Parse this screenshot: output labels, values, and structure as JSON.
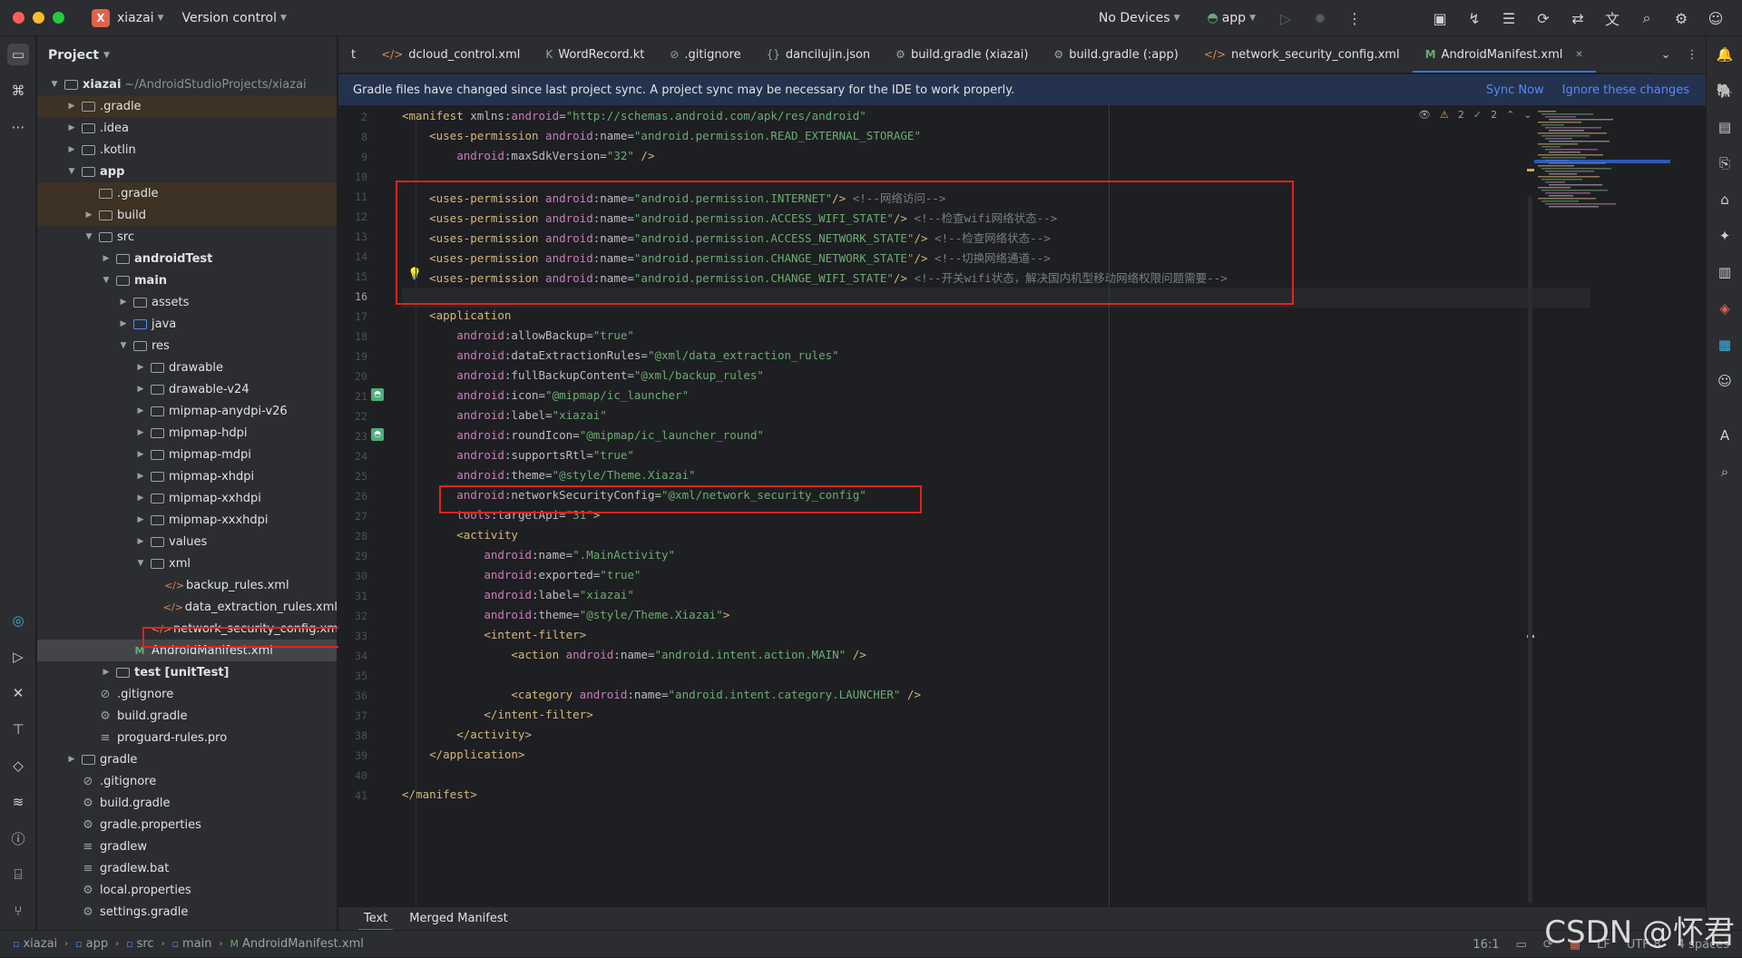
{
  "titlebar": {
    "project_name": "xiazai",
    "project_initial": "X",
    "vcs_label": "Version control",
    "device": "No Devices",
    "run_config": "app"
  },
  "project_panel": {
    "title": "Project",
    "tree": [
      {
        "label": "xiazai",
        "suffix": "~/AndroidStudioProjects/xiazai",
        "depth": 0,
        "arrow": "down",
        "kind": "module",
        "bold": true
      },
      {
        "label": ".gradle",
        "depth": 1,
        "arrow": "right",
        "kind": "folder",
        "hl": "gradle"
      },
      {
        "label": ".idea",
        "depth": 1,
        "arrow": "right",
        "kind": "folder"
      },
      {
        "label": ".kotlin",
        "depth": 1,
        "arrow": "right",
        "kind": "folder"
      },
      {
        "label": "app",
        "depth": 1,
        "arrow": "down",
        "kind": "module",
        "bold": true
      },
      {
        "label": ".gradle",
        "depth": 2,
        "arrow": "",
        "kind": "folder",
        "hl": "gradle"
      },
      {
        "label": "build",
        "depth": 2,
        "arrow": "right",
        "kind": "folder",
        "hl": "gradle"
      },
      {
        "label": "src",
        "depth": 2,
        "arrow": "down",
        "kind": "folder"
      },
      {
        "label": "androidTest",
        "depth": 3,
        "arrow": "right",
        "kind": "module",
        "bold": true
      },
      {
        "label": "main",
        "depth": 3,
        "arrow": "down",
        "kind": "module",
        "bold": true
      },
      {
        "label": "assets",
        "depth": 4,
        "arrow": "right",
        "kind": "module"
      },
      {
        "label": "java",
        "depth": 4,
        "arrow": "right",
        "kind": "blue"
      },
      {
        "label": "res",
        "depth": 4,
        "arrow": "down",
        "kind": "module"
      },
      {
        "label": "drawable",
        "depth": 5,
        "arrow": "right",
        "kind": "folder"
      },
      {
        "label": "drawable-v24",
        "depth": 5,
        "arrow": "right",
        "kind": "folder"
      },
      {
        "label": "mipmap-anydpi-v26",
        "depth": 5,
        "arrow": "right",
        "kind": "folder"
      },
      {
        "label": "mipmap-hdpi",
        "depth": 5,
        "arrow": "right",
        "kind": "folder"
      },
      {
        "label": "mipmap-mdpi",
        "depth": 5,
        "arrow": "right",
        "kind": "folder"
      },
      {
        "label": "mipmap-xhdpi",
        "depth": 5,
        "arrow": "right",
        "kind": "folder"
      },
      {
        "label": "mipmap-xxhdpi",
        "depth": 5,
        "arrow": "right",
        "kind": "folder"
      },
      {
        "label": "mipmap-xxxhdpi",
        "depth": 5,
        "arrow": "right",
        "kind": "folder"
      },
      {
        "label": "values",
        "depth": 5,
        "arrow": "right",
        "kind": "folder"
      },
      {
        "label": "xml",
        "depth": 5,
        "arrow": "down",
        "kind": "folder"
      },
      {
        "label": "backup_rules.xml",
        "depth": 6,
        "arrow": "",
        "kind": "xml"
      },
      {
        "label": "data_extraction_rules.xml",
        "depth": 6,
        "arrow": "",
        "kind": "xml"
      },
      {
        "label": "network_security_config.xml",
        "depth": 6,
        "arrow": "",
        "kind": "xml"
      },
      {
        "label": "AndroidManifest.xml",
        "depth": 4,
        "arrow": "",
        "kind": "manifest",
        "hl": "sel"
      },
      {
        "label": "test [unitTest]",
        "depth": 3,
        "arrow": "right",
        "kind": "module",
        "bold": true
      },
      {
        "label": ".gitignore",
        "depth": 2,
        "arrow": "",
        "kind": "ignore"
      },
      {
        "label": "build.gradle",
        "depth": 2,
        "arrow": "",
        "kind": "gradle"
      },
      {
        "label": "proguard-rules.pro",
        "depth": 2,
        "arrow": "",
        "kind": "text"
      },
      {
        "label": "gradle",
        "depth": 1,
        "arrow": "right",
        "kind": "folder"
      },
      {
        "label": ".gitignore",
        "depth": 1,
        "arrow": "",
        "kind": "ignore"
      },
      {
        "label": "build.gradle",
        "depth": 1,
        "arrow": "",
        "kind": "gradle"
      },
      {
        "label": "gradle.properties",
        "depth": 1,
        "arrow": "",
        "kind": "settings"
      },
      {
        "label": "gradlew",
        "depth": 1,
        "arrow": "",
        "kind": "text"
      },
      {
        "label": "gradlew.bat",
        "depth": 1,
        "arrow": "",
        "kind": "text"
      },
      {
        "label": "local.properties",
        "depth": 1,
        "arrow": "",
        "kind": "settings"
      },
      {
        "label": "settings.gradle",
        "depth": 1,
        "arrow": "",
        "kind": "gradle"
      }
    ]
  },
  "tabs": [
    {
      "label": "t",
      "icon": ""
    },
    {
      "label": "dcloud_control.xml",
      "icon": "</>"
    },
    {
      "label": "WordRecord.kt",
      "icon": "K"
    },
    {
      "label": ".gitignore",
      "icon": "⊘"
    },
    {
      "label": "dancilujin.json",
      "icon": "{}"
    },
    {
      "label": "build.gradle (xiazai)",
      "icon": "⚙"
    },
    {
      "label": "build.gradle (:app)",
      "icon": "⚙"
    },
    {
      "label": "network_security_config.xml",
      "icon": "</>"
    },
    {
      "label": "AndroidManifest.xml",
      "icon": "M",
      "active": true
    }
  ],
  "notice": {
    "message": "Gradle files have changed since last project sync. A project sync may be necessary for the IDE to work properly.",
    "sync": "Sync Now",
    "ignore": "Ignore these changes"
  },
  "inspections": {
    "warnings": "2",
    "ok": "2"
  },
  "code": [
    {
      "n": "2",
      "parts": [
        [
          "t-tag",
          "<manifest "
        ],
        [
          "t-attr",
          "xmlns:"
        ],
        [
          "t-ns",
          "android"
        ],
        [
          "t-attr",
          "="
        ],
        [
          "t-str",
          "\"http://schemas.android.com/apk/res/android\""
        ]
      ]
    },
    {
      "n": "8",
      "parts": [
        [
          "t-tag",
          "    <uses-permission "
        ],
        [
          "t-ns",
          "android"
        ],
        [
          "t-attr",
          ":name="
        ],
        [
          "t-str",
          "\"android.permission.READ_EXTERNAL_STORAGE\""
        ]
      ]
    },
    {
      "n": "9",
      "parts": [
        [
          "t-attr",
          "        "
        ],
        [
          "t-ns",
          "android"
        ],
        [
          "t-attr",
          ":maxSdkVersion="
        ],
        [
          "t-str",
          "\"32\""
        ],
        [
          "t-tag",
          " />"
        ]
      ]
    },
    {
      "n": "10",
      "parts": []
    },
    {
      "n": "11",
      "parts": [
        [
          "t-tag",
          "    <uses-permission "
        ],
        [
          "t-ns",
          "android"
        ],
        [
          "t-attr",
          ":name="
        ],
        [
          "t-str",
          "\"android.permission.INTERNET\""
        ],
        [
          "t-tag",
          "/>"
        ],
        [
          "t-cmt",
          " <!--网络访问-->"
        ]
      ]
    },
    {
      "n": "12",
      "parts": [
        [
          "t-tag",
          "    <uses-permission "
        ],
        [
          "t-ns",
          "android"
        ],
        [
          "t-attr",
          ":name="
        ],
        [
          "t-str",
          "\"android.permission.ACCESS_WIFI_STATE\""
        ],
        [
          "t-tag",
          "/>"
        ],
        [
          "t-cmt",
          " <!--检查wifi网络状态-->"
        ]
      ]
    },
    {
      "n": "13",
      "parts": [
        [
          "t-tag",
          "    <uses-permission "
        ],
        [
          "t-ns",
          "android"
        ],
        [
          "t-attr",
          ":name="
        ],
        [
          "t-str",
          "\"android.permission.ACCESS_NETWORK_STATE\""
        ],
        [
          "t-tag",
          "/>"
        ],
        [
          "t-cmt",
          " <!--检查网络状态-->"
        ]
      ]
    },
    {
      "n": "14",
      "parts": [
        [
          "t-tag",
          "    <uses-permission "
        ],
        [
          "t-ns",
          "android"
        ],
        [
          "t-attr",
          ":name="
        ],
        [
          "t-str",
          "\"android.permission.CHANGE_NETWORK_STATE\""
        ],
        [
          "t-tag",
          "/>"
        ],
        [
          "t-cmt",
          " <!--切换网络通道-->"
        ]
      ]
    },
    {
      "n": "15",
      "parts": [
        [
          "t-tag",
          "    <uses-permission "
        ],
        [
          "t-ns",
          "android"
        ],
        [
          "t-attr",
          ":name="
        ],
        [
          "t-str",
          "\"android.permission.CHANGE_WIFI_STATE\""
        ],
        [
          "t-tag",
          "/>"
        ],
        [
          "t-cmt",
          " <!--开关wifi状态，解决国内机型移动网络权限问题需要-->"
        ]
      ]
    },
    {
      "n": "16",
      "parts": []
    },
    {
      "n": "17",
      "parts": [
        [
          "t-tag",
          "    <application"
        ]
      ]
    },
    {
      "n": "18",
      "parts": [
        [
          "t-attr",
          "        "
        ],
        [
          "t-ns",
          "android"
        ],
        [
          "t-attr",
          ":allowBackup="
        ],
        [
          "t-str",
          "\"true\""
        ]
      ]
    },
    {
      "n": "19",
      "parts": [
        [
          "t-attr",
          "        "
        ],
        [
          "t-ns",
          "android"
        ],
        [
          "t-attr",
          ":dataExtractionRules="
        ],
        [
          "t-str",
          "\"@xml/data_extraction_rules\""
        ]
      ]
    },
    {
      "n": "20",
      "parts": [
        [
          "t-attr",
          "        "
        ],
        [
          "t-ns",
          "android"
        ],
        [
          "t-attr",
          ":fullBackupContent="
        ],
        [
          "t-str",
          "\"@xml/backup_rules\""
        ]
      ]
    },
    {
      "n": "21",
      "parts": [
        [
          "t-attr",
          "        "
        ],
        [
          "t-ns",
          "android"
        ],
        [
          "t-attr",
          ":icon="
        ],
        [
          "t-str",
          "\"@mipmap/ic_launcher\""
        ]
      ]
    },
    {
      "n": "22",
      "parts": [
        [
          "t-attr",
          "        "
        ],
        [
          "t-ns",
          "android"
        ],
        [
          "t-attr",
          ":label="
        ],
        [
          "t-str",
          "\"xiazai\""
        ]
      ]
    },
    {
      "n": "23",
      "parts": [
        [
          "t-attr",
          "        "
        ],
        [
          "t-ns",
          "android"
        ],
        [
          "t-attr",
          ":roundIcon="
        ],
        [
          "t-str",
          "\"@mipmap/ic_launcher_round\""
        ]
      ]
    },
    {
      "n": "24",
      "parts": [
        [
          "t-attr",
          "        "
        ],
        [
          "t-ns",
          "android"
        ],
        [
          "t-attr",
          ":supportsRtl="
        ],
        [
          "t-str",
          "\"true\""
        ]
      ]
    },
    {
      "n": "25",
      "parts": [
        [
          "t-attr",
          "        "
        ],
        [
          "t-ns",
          "android"
        ],
        [
          "t-attr",
          ":theme="
        ],
        [
          "t-str",
          "\"@style/Theme.Xiazai\""
        ]
      ]
    },
    {
      "n": "26",
      "parts": [
        [
          "t-attr",
          "        "
        ],
        [
          "t-ns",
          "android"
        ],
        [
          "t-attr",
          ":networkSecurityConfig="
        ],
        [
          "t-str",
          "\"@xml/network_security_config\""
        ]
      ]
    },
    {
      "n": "27",
      "parts": [
        [
          "t-attr",
          "        "
        ],
        [
          "t-ns",
          "tools"
        ],
        [
          "t-attr",
          ":targetApi="
        ],
        [
          "t-str",
          "\"31\""
        ],
        [
          "t-tag",
          ">"
        ]
      ]
    },
    {
      "n": "28",
      "parts": [
        [
          "t-tag",
          "        <activity"
        ]
      ]
    },
    {
      "n": "29",
      "parts": [
        [
          "t-attr",
          "            "
        ],
        [
          "t-ns",
          "android"
        ],
        [
          "t-attr",
          ":name="
        ],
        [
          "t-str",
          "\".MainActivity\""
        ]
      ]
    },
    {
      "n": "30",
      "parts": [
        [
          "t-attr",
          "            "
        ],
        [
          "t-ns",
          "android"
        ],
        [
          "t-attr",
          ":exported="
        ],
        [
          "t-str",
          "\"true\""
        ]
      ]
    },
    {
      "n": "31",
      "parts": [
        [
          "t-attr",
          "            "
        ],
        [
          "t-ns",
          "android"
        ],
        [
          "t-attr",
          ":label="
        ],
        [
          "t-str",
          "\"xiazai\""
        ]
      ]
    },
    {
      "n": "32",
      "parts": [
        [
          "t-attr",
          "            "
        ],
        [
          "t-ns",
          "android"
        ],
        [
          "t-attr",
          ":theme="
        ],
        [
          "t-str",
          "\"@style/Theme.Xiazai\""
        ],
        [
          "t-tag",
          ">"
        ]
      ]
    },
    {
      "n": "33",
      "parts": [
        [
          "t-tag",
          "            <intent-filter>"
        ]
      ]
    },
    {
      "n": "34",
      "parts": [
        [
          "t-tag",
          "                <action "
        ],
        [
          "t-ns",
          "android"
        ],
        [
          "t-attr",
          ":name="
        ],
        [
          "t-str",
          "\"android.intent.action.MAIN\""
        ],
        [
          "t-tag",
          " />"
        ]
      ]
    },
    {
      "n": "35",
      "parts": []
    },
    {
      "n": "36",
      "parts": [
        [
          "t-tag",
          "                <category "
        ],
        [
          "t-ns",
          "android"
        ],
        [
          "t-attr",
          ":name="
        ],
        [
          "t-str",
          "\"android.intent.category.LAUNCHER\""
        ],
        [
          "t-tag",
          " />"
        ]
      ]
    },
    {
      "n": "37",
      "parts": [
        [
          "t-tag",
          "            </intent-filter>"
        ]
      ]
    },
    {
      "n": "38",
      "parts": [
        [
          "t-tag",
          "        </activity>"
        ]
      ]
    },
    {
      "n": "39",
      "parts": [
        [
          "t-tag",
          "    </application>"
        ]
      ]
    },
    {
      "n": "40",
      "parts": []
    },
    {
      "n": "41",
      "parts": [
        [
          "t-tag",
          "</manifest>"
        ]
      ]
    }
  ],
  "bottom_tabs": [
    "Text",
    "Merged Manifest"
  ],
  "statusbar": {
    "breadcrumb": [
      "xiazai",
      "app",
      "src",
      "main",
      "AndroidManifest.xml"
    ],
    "position": "16:1",
    "line_sep": "LF",
    "encoding": "UTF-8",
    "indent": "4 spaces"
  },
  "watermark": "CSDN @怀君"
}
